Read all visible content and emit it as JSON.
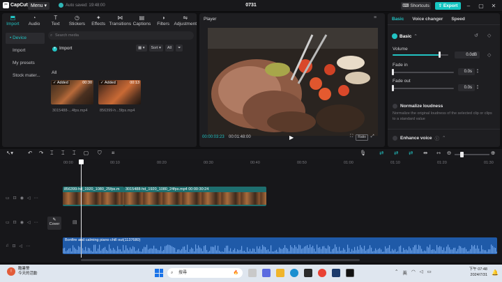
{
  "app": {
    "logo": "CapCut",
    "menu_label": "Menu",
    "autosave": "Auto saved: 19:48:00",
    "project_title": "0731",
    "shortcuts_label": "Shortcuts",
    "export_label": "Export"
  },
  "tool_tabs": [
    {
      "label": "Import",
      "icon": "import-icon"
    },
    {
      "label": "Audio",
      "icon": "audio-icon"
    },
    {
      "label": "Text",
      "icon": "text-icon"
    },
    {
      "label": "Stickers",
      "icon": "stickers-icon"
    },
    {
      "label": "Effects",
      "icon": "effects-icon"
    },
    {
      "label": "Transitions",
      "icon": "transitions-icon"
    },
    {
      "label": "Captions",
      "icon": "captions-icon"
    },
    {
      "label": "Filters",
      "icon": "filters-icon"
    },
    {
      "label": "Adjustment",
      "icon": "adjustment-icon"
    }
  ],
  "left_nav": [
    "• Device",
    "Import",
    "My presets",
    "Stock mater..."
  ],
  "media": {
    "search_placeholder": "Search media",
    "import_label": "Import",
    "sort_label": "Sort",
    "all_filter": "All",
    "all_heading": "All",
    "items": [
      {
        "badge": "Added",
        "duration": "00:30",
        "name": "3015488-...4fps.mp4"
      },
      {
        "badge": "Added",
        "duration": "00:13",
        "name": "856399-h...5fps.mp4"
      }
    ]
  },
  "player": {
    "title": "Player",
    "current_time": "00:00:03:23",
    "total_time": "00:01:48:00",
    "ratio_label": "Ratio"
  },
  "right_panel": {
    "tabs": [
      "Basic",
      "Voice changer",
      "Speed"
    ],
    "basic_heading": "Basic",
    "volume_label": "Volume",
    "volume_value": "0.0dB",
    "volume_level": 0.86,
    "fade_in_label": "Fade in",
    "fade_in_value": "0.0s",
    "fade_out_label": "Fade out",
    "fade_out_value": "0.0s",
    "normalize_label": "Normalize loudness",
    "normalize_desc": "Normalize the original loudness of the selected clip or clips to a standard value",
    "enhance_label": "Enhance voice"
  },
  "timeline": {
    "ruler": [
      "00:00",
      "00:10",
      "00:20",
      "00:30",
      "00:40",
      "00:50",
      "01:00",
      "01:10",
      "01:20",
      "01:30"
    ],
    "video_clips": [
      {
        "label": "856399-hd_1920_1080_25fps.m"
      },
      {
        "label": "3015488-hd_1920_1080_24fps.mp4  00:00:30:24"
      }
    ],
    "cover_label": "Cover",
    "audio_clip_label": "Bonfire and calming piano chill out(1137680)"
  },
  "taskbar": {
    "weather_title": "酷暑警",
    "weather_sub": "今天的活動",
    "search_label": "搜尋",
    "ime": "英",
    "time": "下午 07:48",
    "date": "2024/7/31"
  },
  "colors": {
    "accent": "#22c3c3",
    "export": "#16c6c1",
    "video_clip": "#1e6f6f",
    "audio_clip": "#1f5aa8"
  }
}
